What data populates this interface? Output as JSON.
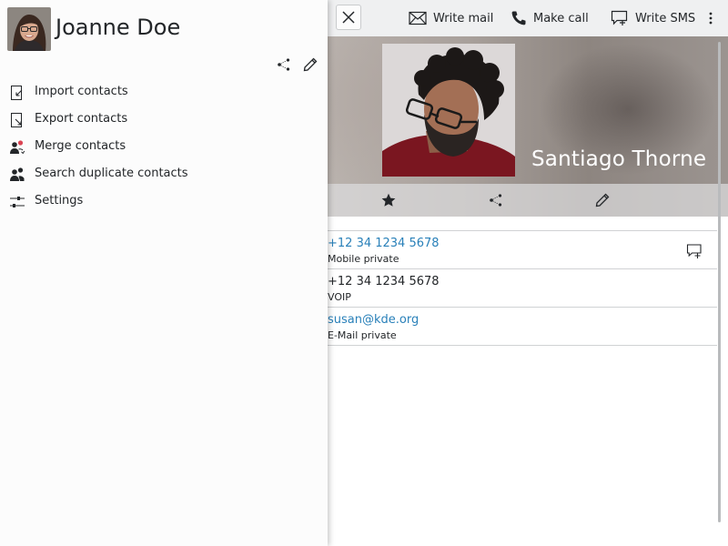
{
  "drawer": {
    "user_name": "Joanne Doe",
    "menu": [
      {
        "label": "Import contacts",
        "icon": "import-icon"
      },
      {
        "label": "Export contacts",
        "icon": "export-icon"
      },
      {
        "label": "Merge contacts",
        "icon": "merge-icon"
      },
      {
        "label": "Search duplicate contacts",
        "icon": "duplicate-search-icon"
      },
      {
        "label": "Settings",
        "icon": "settings-icon"
      }
    ]
  },
  "toolbar": {
    "write_mail": "Write mail",
    "make_call": "Make call",
    "write_sms": "Write SMS"
  },
  "contact": {
    "name": "Santiago Thorne",
    "details": [
      {
        "value": "+12 34 1234 5678",
        "type": "Mobile private",
        "link": true
      },
      {
        "value": "+12 34 1234 5678",
        "type": "VOIP",
        "link": false
      },
      {
        "value": "susan@kde.org",
        "type": "E-Mail private",
        "link": true
      }
    ]
  },
  "colors": {
    "link": "#2980b9",
    "text": "#232629",
    "drawer_bg": "#fcfcfc",
    "toolbar_bg": "#eff0f1"
  }
}
